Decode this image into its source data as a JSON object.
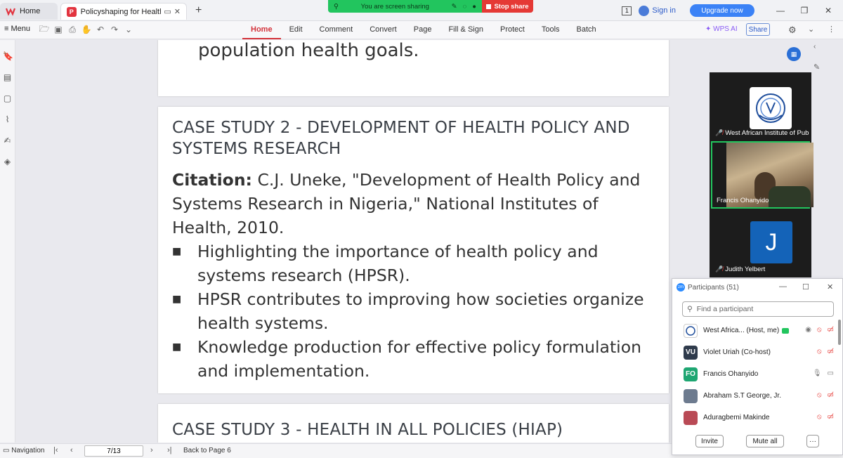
{
  "tabs": {
    "home_label": "Home",
    "doc_title": "Policyshaping for Health Deve",
    "new_tab": "+"
  },
  "share_banner": {
    "text": "You are screen sharing",
    "stop": "Stop share"
  },
  "top_right": {
    "badge": "1",
    "signin": "Sign in",
    "upgrade": "Upgrade now"
  },
  "menubar": {
    "menu": "Menu",
    "tabs": [
      "Home",
      "Edit",
      "Comment",
      "Convert",
      "Page",
      "Fill & Sign",
      "Protect",
      "Tools",
      "Batch"
    ],
    "active_tab": "Home",
    "wps_ai": "WPS AI",
    "share": "Share"
  },
  "document": {
    "prev_tail": "population health goals.",
    "case2": {
      "title_line1": "CASE STUDY 2 - DEVELOPMENT OF HEALTH POLICY AND",
      "title_line2": "SYSTEMS RESEARCH",
      "citation_label": "Citation:",
      "citation_text": " C.J. Uneke, \"Development of Health Policy and Systems Research in Nigeria,\" National Institutes of Health, 2010.",
      "bullets": [
        "Highlighting the importance of health policy and systems research (HPSR).",
        "HPSR contributes to improving how societies organize health systems.",
        "Knowledge production for effective policy formulation and implementation."
      ]
    },
    "case3": {
      "title": "CASE STUDY 3 - HEALTH IN ALL POLICIES (HIAP)"
    }
  },
  "statusbar": {
    "navigation": "Navigation",
    "page_value": "7/13",
    "back_to": "Back to Page 6"
  },
  "gallery": {
    "tile1_name": "West African Institute of Public H...",
    "tile2_name": "Francis Ohanyido",
    "tile3_initial": "J",
    "tile3_name": "Judith Yelbert"
  },
  "participants": {
    "title": "Participants (51)",
    "search_placeholder": "Find a participant",
    "rows": [
      {
        "initials": "",
        "name": "West Africa... (Host, me)",
        "color": "#ffffff"
      },
      {
        "initials": "VU",
        "name": "Violet Uriah (Co-host)",
        "color": "#2f3b4c"
      },
      {
        "initials": "FO",
        "name": "Francis Ohanyido",
        "color": "#1ea672"
      },
      {
        "initials": "",
        "name": "Abraham S.T George, Jr.",
        "color": "#6d7b8f"
      },
      {
        "initials": "",
        "name": "Aduragbemi Makinde",
        "color": "#b94a55"
      }
    ],
    "invite": "Invite",
    "mute_all": "Mute all",
    "more": "···"
  }
}
